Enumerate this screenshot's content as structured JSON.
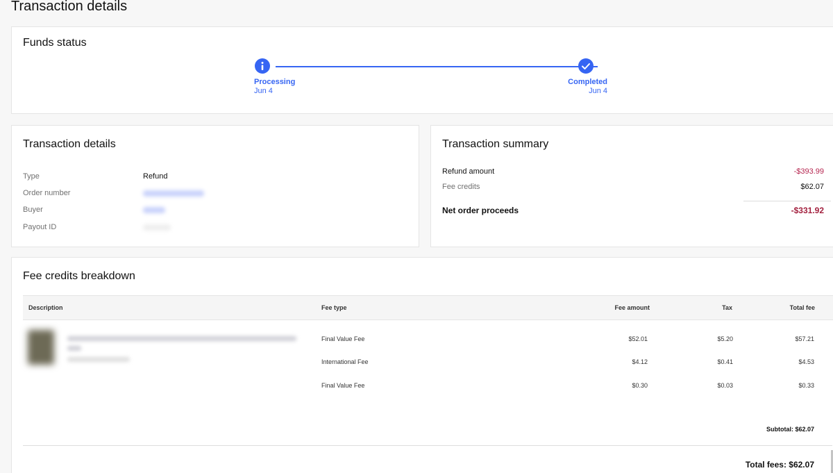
{
  "page": {
    "title": "Transaction details"
  },
  "funds_status": {
    "title": "Funds status",
    "steps": [
      {
        "label": "Processing",
        "date": "Jun 4",
        "icon": "info-icon"
      },
      {
        "label": "Completed",
        "date": "Jun 4",
        "icon": "checkmark-icon"
      }
    ],
    "accent": "#3665f3"
  },
  "transaction_details": {
    "title": "Transaction details",
    "rows": [
      {
        "label": "Type",
        "value": "Refund"
      },
      {
        "label": "Order number",
        "value": ""
      },
      {
        "label": "Buyer",
        "value": ""
      },
      {
        "label": "Payout ID",
        "value": ""
      }
    ]
  },
  "summary": {
    "title": "Transaction summary",
    "refund_label": "Refund amount",
    "refund_value": "-$393.99",
    "fee_credits_label": "Fee credits",
    "fee_credits_value": "$62.07",
    "net_label": "Net order proceeds",
    "net_value": "-$331.92",
    "negative_color": "#a3213f"
  },
  "fee_breakdown": {
    "title": "Fee credits breakdown",
    "columns": [
      "Description",
      "Fee type",
      "Fee amount",
      "Tax",
      "Total fee"
    ],
    "rows": [
      {
        "fee_type": "Final Value Fee",
        "fee_amount": "$52.01",
        "tax": "$5.20",
        "total": "$57.21"
      },
      {
        "fee_type": "International Fee",
        "fee_amount": "$4.12",
        "tax": "$0.41",
        "total": "$4.53"
      },
      {
        "fee_type": "Final Value Fee",
        "fee_amount": "$0.30",
        "tax": "$0.03",
        "total": "$0.33"
      }
    ],
    "subtotal": "Subtotal: $62.07",
    "total_fees": "Total fees: $62.07"
  }
}
